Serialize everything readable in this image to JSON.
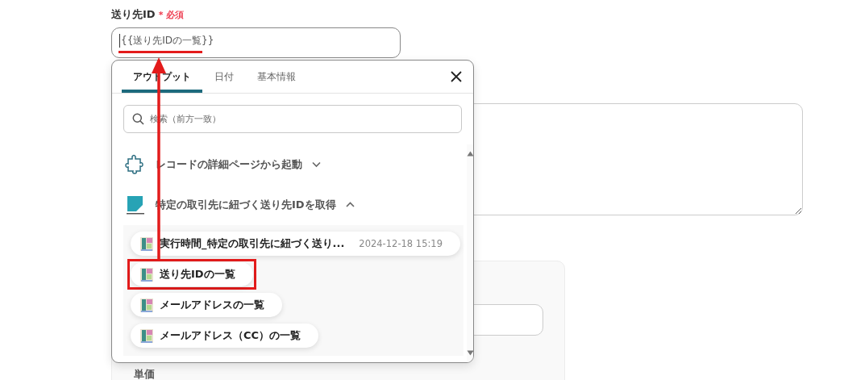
{
  "field": {
    "label": "送り先ID",
    "required_mark": "*",
    "required_text": "必須",
    "value": "{{送り先IDの一覧}}",
    "underlined": true
  },
  "picker": {
    "tabs": [
      {
        "label": "アウトプット",
        "selected": true
      },
      {
        "label": "日付",
        "selected": false
      },
      {
        "label": "基本情報",
        "selected": false
      }
    ],
    "search": {
      "placeholder": "検索（前方一致）"
    },
    "sections": [
      {
        "kind": "trigger",
        "title": "レコードの詳細ページから起動",
        "expanded": false
      },
      {
        "kind": "app",
        "title": "特定の取引先に紐づく送り先IDを取得",
        "expanded": true,
        "items": [
          {
            "label": "実行時間_特定の取引先に紐づく送り...",
            "timestamp": "2024-12-18 15:19",
            "highlighted": false
          },
          {
            "label": "送り先IDの一覧",
            "highlighted": true
          },
          {
            "label": "メールアドレスの一覧",
            "highlighted": false
          },
          {
            "label": "メールアドレス（CC）の一覧",
            "highlighted": false
          }
        ]
      }
    ]
  },
  "lower_card": {
    "label": "単価"
  }
}
